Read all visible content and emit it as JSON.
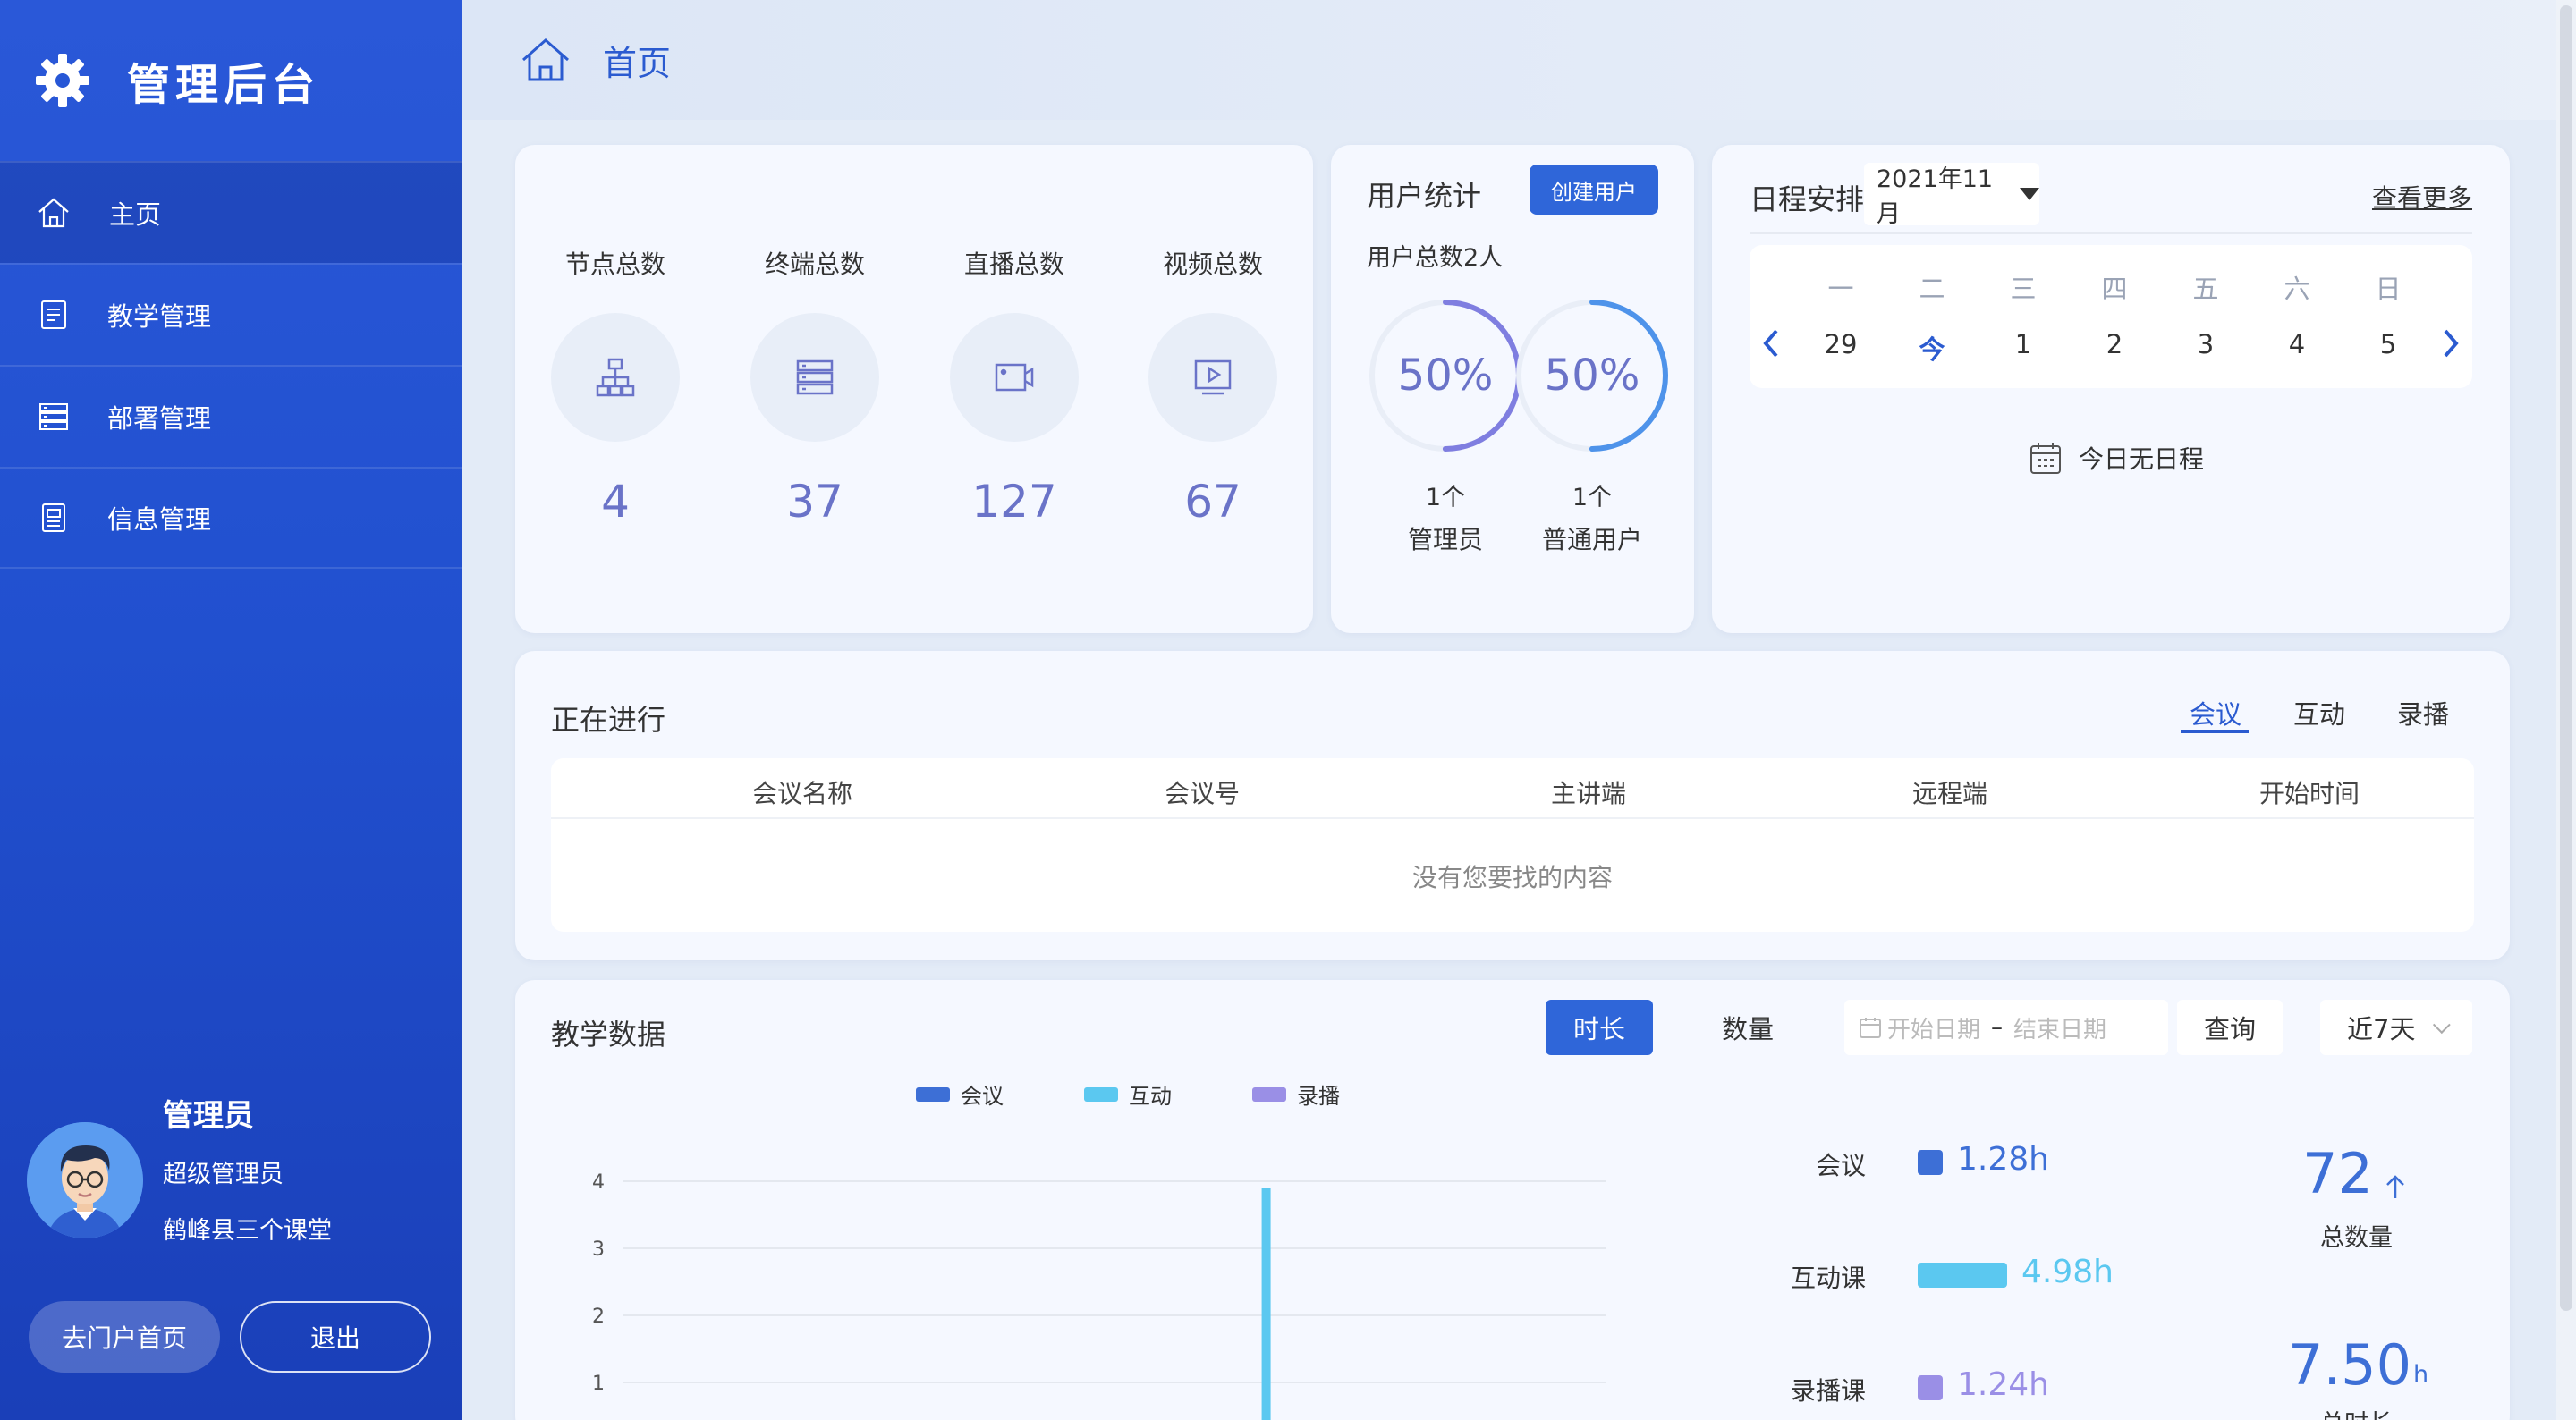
{
  "brand": {
    "title": "管理后台"
  },
  "nav": [
    {
      "label": "主页",
      "icon": "home-icon",
      "active": true
    },
    {
      "label": "教学管理",
      "icon": "document-icon",
      "active": false
    },
    {
      "label": "部署管理",
      "icon": "server-list-icon",
      "active": false
    },
    {
      "label": "信息管理",
      "icon": "info-doc-icon",
      "active": false
    }
  ],
  "profile": {
    "name": "管理员",
    "role": "超级管理员",
    "org": "鹤峰县三个课堂"
  },
  "sidebar_buttons": {
    "portal": "去门户首页",
    "logout": "退出"
  },
  "header": {
    "breadcrumb": "首页"
  },
  "stats": [
    {
      "label": "节点总数",
      "value": "4",
      "icon": "hierarchy-icon"
    },
    {
      "label": "终端总数",
      "value": "37",
      "icon": "server-icon"
    },
    {
      "label": "直播总数",
      "value": "127",
      "icon": "video-camera-icon"
    },
    {
      "label": "视频总数",
      "value": "67",
      "icon": "video-play-icon"
    }
  ],
  "user_stats": {
    "title": "用户统计",
    "create_button": "创建用户",
    "total": "用户总数2人",
    "rings": [
      {
        "percent_label": "50%",
        "percent": 0.5,
        "count": "1个",
        "label": "管理员",
        "color": "#7f7ee0"
      },
      {
        "percent_label": "50%",
        "percent": 0.5,
        "count": "1个",
        "label": "普通用户",
        "color": "#4e93ea"
      }
    ]
  },
  "schedule": {
    "title": "日程安排",
    "month": "2021年11月",
    "more": "查看更多",
    "weekdays": [
      "一",
      "二",
      "三",
      "四",
      "五",
      "六",
      "日"
    ],
    "days": [
      "29",
      "今",
      "1",
      "2",
      "3",
      "4",
      "5"
    ],
    "empty": "今日无日程"
  },
  "ongoing": {
    "title": "正在进行",
    "tabs": [
      "会议",
      "互动",
      "录播"
    ],
    "active_tab": 0,
    "columns": [
      "会议名称",
      "会议号",
      "主讲端",
      "远程端",
      "开始时间"
    ],
    "empty": "没有您要找的内容"
  },
  "teaching": {
    "title": "教学数据",
    "toggle": [
      "时长",
      "数量"
    ],
    "toggle_active": 0,
    "start_placeholder": "开始日期",
    "range_sep": "–",
    "end_placeholder": "结束日期",
    "query": "查询",
    "period": "近7天",
    "summary": [
      {
        "label": "会议",
        "value": "1.28h",
        "color": "#3d6fd6",
        "bar": 0.05
      },
      {
        "label": "互动课",
        "value": "4.98h",
        "color": "#5bc8f0",
        "bar": 1.0
      },
      {
        "label": "录播课",
        "value": "1.24h",
        "color": "#9a8fe6",
        "bar": 0.05
      }
    ],
    "total_count": "72",
    "total_count_label": "总数量",
    "total_duration": "7.50",
    "total_duration_unit": "h",
    "total_duration_label": "总时长"
  },
  "chart_data": {
    "type": "bar",
    "legend": [
      "会议",
      "互动",
      "录播"
    ],
    "yticks": [
      1,
      2,
      3,
      4
    ],
    "ylim": [
      0,
      4.2
    ],
    "groups": 7,
    "series": [
      {
        "name": "会议",
        "color": "#3d6fd6",
        "values": [
          0.05,
          0,
          0,
          0,
          0.05,
          0,
          0
        ]
      },
      {
        "name": "互动",
        "color": "#5bc8f0",
        "values": [
          0,
          0.25,
          0,
          0,
          3.9,
          0,
          0
        ]
      },
      {
        "name": "录播",
        "color": "#9a8fe6",
        "values": [
          0.05,
          0,
          0,
          0,
          0,
          0.4,
          0
        ]
      }
    ]
  }
}
